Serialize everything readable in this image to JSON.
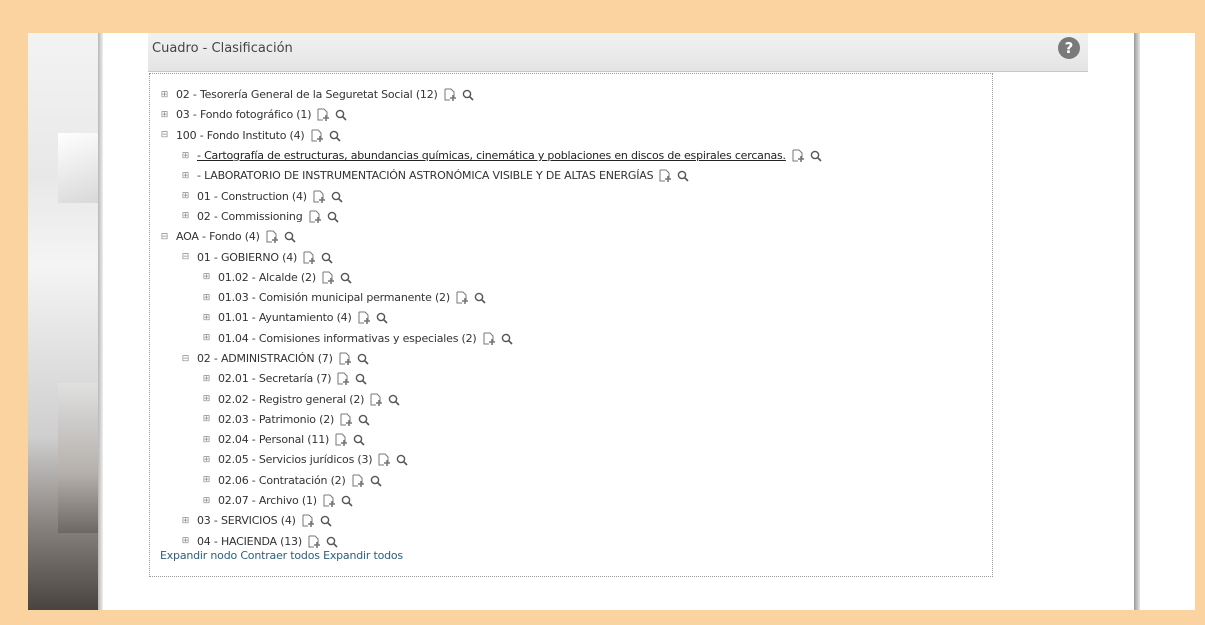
{
  "panel": {
    "title": "Cuadro - Clasificación",
    "help_glyph": "?"
  },
  "tree": [
    {
      "label": "02 - Tesorería General de la Seguretat Social (12)",
      "depth": 0,
      "state": "collapsed"
    },
    {
      "label": "03 - Fondo fotográfico (1)",
      "depth": 0,
      "state": "collapsed"
    },
    {
      "label": "100 - Fondo Instituto (4)",
      "depth": 0,
      "state": "expanded"
    },
    {
      "label": "- Cartografía de estructuras, abundancias químicas, cinemática y poblaciones en discos de espirales cercanas.",
      "depth": 1,
      "state": "leaf",
      "underline": true
    },
    {
      "label": "- LABORATORIO DE INSTRUMENTACIÓN ASTRONÓMICA VISIBLE Y DE ALTAS ENERGÍAS",
      "depth": 1,
      "state": "leaf"
    },
    {
      "label": "01 - Construction (4)",
      "depth": 1,
      "state": "collapsed"
    },
    {
      "label": "02 - Commissioning",
      "depth": 1,
      "state": "collapsed"
    },
    {
      "label": "AOA - Fondo (4)",
      "depth": 0,
      "state": "expanded"
    },
    {
      "label": "01 - GOBIERNO (4)",
      "depth": 1,
      "state": "expanded"
    },
    {
      "label": "01.02 - Alcalde (2)",
      "depth": 2,
      "state": "collapsed"
    },
    {
      "label": "01.03 - Comisión municipal permanente (2)",
      "depth": 2,
      "state": "collapsed"
    },
    {
      "label": "01.01 - Ayuntamiento (4)",
      "depth": 2,
      "state": "collapsed"
    },
    {
      "label": "01.04 - Comisiones informativas y especiales (2)",
      "depth": 2,
      "state": "collapsed"
    },
    {
      "label": "02 - ADMINISTRACIÓN (7)",
      "depth": 1,
      "state": "expanded"
    },
    {
      "label": "02.01 - Secretaría (7)",
      "depth": 2,
      "state": "collapsed"
    },
    {
      "label": "02.02 - Registro general (2)",
      "depth": 2,
      "state": "collapsed"
    },
    {
      "label": "02.03 - Patrimonio (2)",
      "depth": 2,
      "state": "collapsed"
    },
    {
      "label": "02.04 - Personal (11)",
      "depth": 2,
      "state": "collapsed"
    },
    {
      "label": "02.05 - Servicios jurídicos (3)",
      "depth": 2,
      "state": "collapsed"
    },
    {
      "label": "02.06 - Contratación (2)",
      "depth": 2,
      "state": "collapsed"
    },
    {
      "label": "02.07 - Archivo (1)",
      "depth": 2,
      "state": "collapsed"
    },
    {
      "label": "03 - SERVICIOS (4)",
      "depth": 1,
      "state": "collapsed"
    },
    {
      "label": "04 - HACIENDA (13)",
      "depth": 1,
      "state": "collapsed"
    }
  ],
  "footer": {
    "expand_node": "Expandir nodo",
    "collapse_all": "Contraer todos",
    "expand_all": "Expandir todos"
  },
  "icons": {
    "toggle_expanded": "minus-box-icon",
    "toggle_collapsed": "plus-box-icon",
    "add": "add-document-icon",
    "search": "magnifier-icon"
  },
  "colors": {
    "page_background": "#fbd3a0",
    "footer_link": "#2f5f7a",
    "header_bg": "#e9e9e9"
  }
}
